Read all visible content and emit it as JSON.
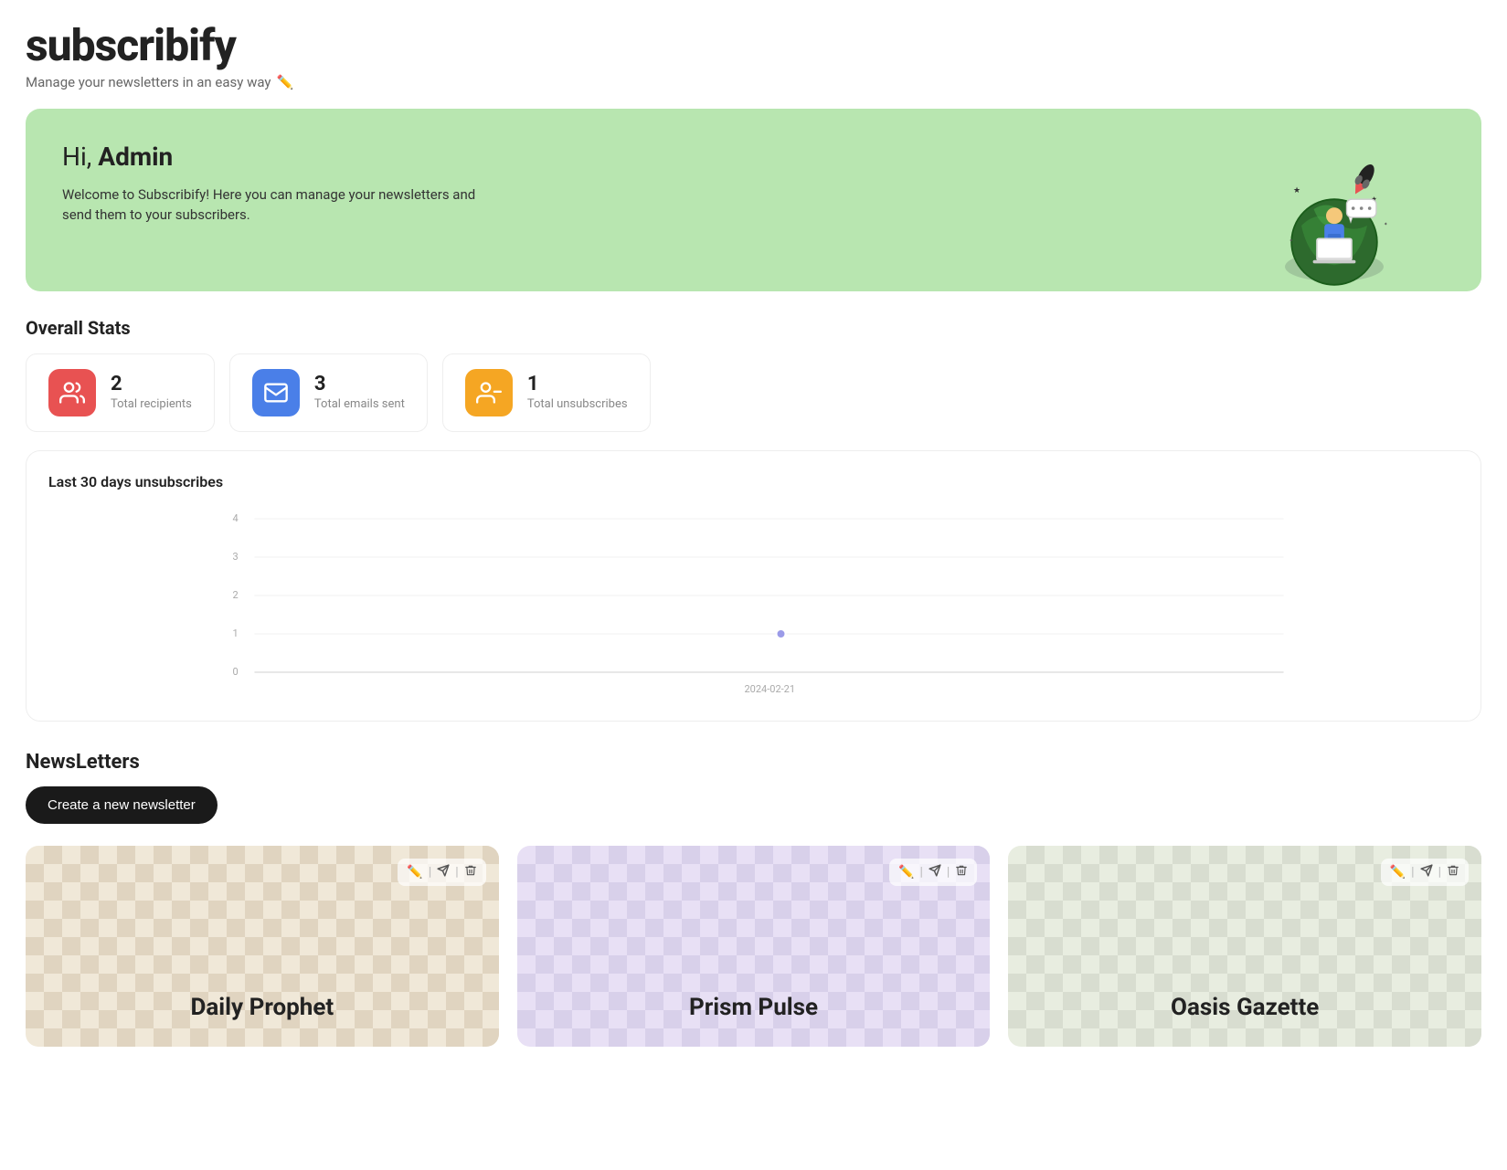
{
  "app": {
    "title": "subscribify",
    "subtitle": "Manage your newsletters in an easy way",
    "subtitle_emoji": "✏️"
  },
  "hero": {
    "greeting_prefix": "Hi,",
    "greeting_name": "Admin",
    "description": "Welcome to Subscribify! Here you can manage your newsletters and send them to your subscribers."
  },
  "stats": {
    "section_title": "Overall Stats",
    "items": [
      {
        "id": "recipients",
        "value": "2",
        "label": "Total recipients",
        "icon_type": "people",
        "color": "red"
      },
      {
        "id": "emails",
        "value": "3",
        "label": "Total emails sent",
        "icon_type": "mail",
        "color": "blue"
      },
      {
        "id": "unsubscribes",
        "value": "1",
        "label": "Total unsubscribes",
        "icon_type": "people-minus",
        "color": "orange"
      }
    ]
  },
  "chart": {
    "title": "Last 30 days unsubscribes",
    "y_labels": [
      "4",
      "3",
      "2",
      "1",
      "0"
    ],
    "x_label": "2024-02-21",
    "data_point_x": 620,
    "data_point_y": 614,
    "y_max": 4,
    "y_min": 0
  },
  "newsletters": {
    "section_title": "NewsLetters",
    "create_button": "Create a new newsletter",
    "items": [
      {
        "id": "daily-prophet",
        "title": "Daily Prophet",
        "bg": "beige"
      },
      {
        "id": "prism-pulse",
        "title": "Prism Pulse",
        "bg": "lavender"
      },
      {
        "id": "oasis-gazette",
        "title": "Oasis Gazette",
        "bg": "sage"
      }
    ]
  },
  "icons": {
    "edit": "✏️",
    "send": "➤",
    "delete": "🗑"
  }
}
